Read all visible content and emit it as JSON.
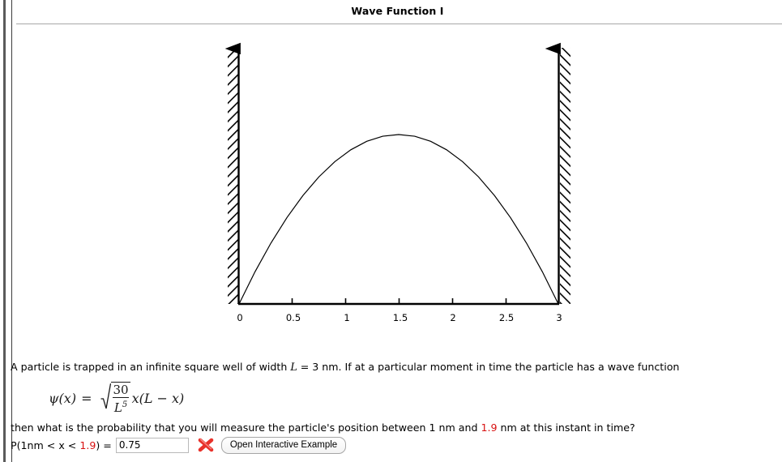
{
  "header": {
    "title": "Wave Function I"
  },
  "figure": {
    "alt": "infinite square well wave function plot",
    "x_ticks": [
      "0",
      "0.5",
      "1",
      "1.5",
      "2",
      "2.5",
      "3"
    ],
    "left_wall_label": "infinite-potential-wall-left",
    "right_wall_label": "infinite-potential-wall-right"
  },
  "chart_data": {
    "type": "line",
    "title": "Wave Function I",
    "xlabel": "",
    "ylabel": "",
    "xlim": [
      0,
      3
    ],
    "ylim": [
      0,
      1.0
    ],
    "grid": false,
    "legend": null,
    "xticks": [
      0,
      0.5,
      1,
      1.5,
      2,
      2.5,
      3
    ],
    "xticklabels": [
      "0",
      "0.5",
      "1",
      "1.5",
      "2",
      "2.5",
      "3"
    ],
    "series": [
      {
        "name": "psi(x) = sqrt(30/L^5) x (L - x)",
        "x": [
          0,
          0.15,
          0.3,
          0.45,
          0.6,
          0.75,
          0.9,
          1.05,
          1.2,
          1.35,
          1.5,
          1.65,
          1.8,
          1.95,
          2.1,
          2.25,
          2.4,
          2.55,
          2.7,
          2.85,
          3.0
        ],
        "y": [
          0,
          0.19,
          0.36,
          0.51,
          0.64,
          0.75,
          0.84,
          0.91,
          0.96,
          0.99,
          1.0,
          0.99,
          0.96,
          0.91,
          0.84,
          0.75,
          0.64,
          0.51,
          0.36,
          0.19,
          0
        ]
      }
    ],
    "annotations": [
      {
        "text": "infinite wall at x = 0"
      },
      {
        "text": "infinite wall at x = 3"
      }
    ]
  },
  "problem": {
    "line1_part1": "A particle is trapped in an infinite square well of width ",
    "line1_var": "L",
    "line1_part2": " = 3 nm. If at a particular moment in time the particle has a wave function",
    "formula": {
      "lhs_psi": "ψ",
      "lhs_arg": "(x)",
      "equals": "=",
      "numerator": "30",
      "denominator_base": "L",
      "denominator_exp": "5",
      "tail": "x(L − x)",
      "plain": "psi(x) = sqrt(30/L^5) x(L - x)"
    },
    "line2_part1": "then what is the probability that you will measure the particle's position between 1 nm and ",
    "line2_value": "1.9",
    "line2_part2": " nm at this instant in time?"
  },
  "answer": {
    "label_part1": "P(1nm < x < ",
    "label_value": "1.9",
    "label_part2": ") = ",
    "input_value": "0.75",
    "input_placeholder": "",
    "status": "incorrect",
    "button_label": "Open Interactive Example"
  },
  "colors": {
    "red": "#d81111",
    "incorrect_x": "#e8312a",
    "border": "#a8a8a8",
    "text": "#000000"
  }
}
